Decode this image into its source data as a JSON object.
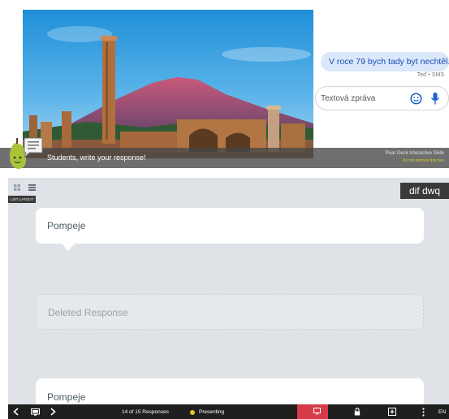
{
  "slide": {
    "message_bubble": "V roce 79 bych tady byt nechtěl.",
    "message_meta": "Teď • SMS",
    "compose_placeholder": "Textová zpráva",
    "prompt": "Students, write your response!",
    "deck_title": "Pear Deck Interactive Slide",
    "deck_subtitle": "Do not remove this box"
  },
  "responses": {
    "layout_tooltip": "LIST LAYOUT",
    "student_name": "dif dwq",
    "items": [
      {
        "text": "Pompeje",
        "status": "normal"
      },
      {
        "text": "Deleted Response",
        "status": "deleted"
      },
      {
        "text": "Pompeje",
        "status": "normal"
      }
    ]
  },
  "toolbar": {
    "response_count": "14 of 15 Responses",
    "status": "Presenting",
    "status_color": "#e3c62c",
    "stop_color": "#d63b4a",
    "language": "EN"
  }
}
